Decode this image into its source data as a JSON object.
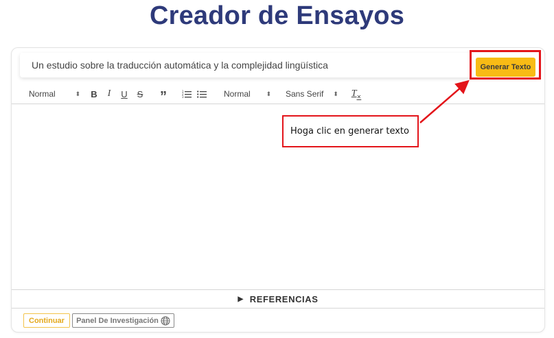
{
  "page": {
    "title": "Creador de Ensayos"
  },
  "prompt": {
    "value": "Un estudio sobre la traducción automática y la complejidad lingüística",
    "generate_label": "Generar Texto"
  },
  "toolbar": {
    "heading_select": "Normal",
    "bold": "B",
    "italic": "I",
    "underline": "U",
    "strike": "S",
    "quote": "”",
    "size_select": "Normal",
    "font_select": "Sans Serif",
    "clear_format": "T"
  },
  "references": {
    "label": "REFERENCIAS"
  },
  "footer": {
    "continue_label": "Continuar",
    "research_label": "Panel De Investigación"
  },
  "annotation": {
    "text": "Hoga clic en generar texto"
  },
  "colors": {
    "title": "#2e3a7a",
    "accent": "#f8bb15",
    "annotation": "#e3141a"
  }
}
